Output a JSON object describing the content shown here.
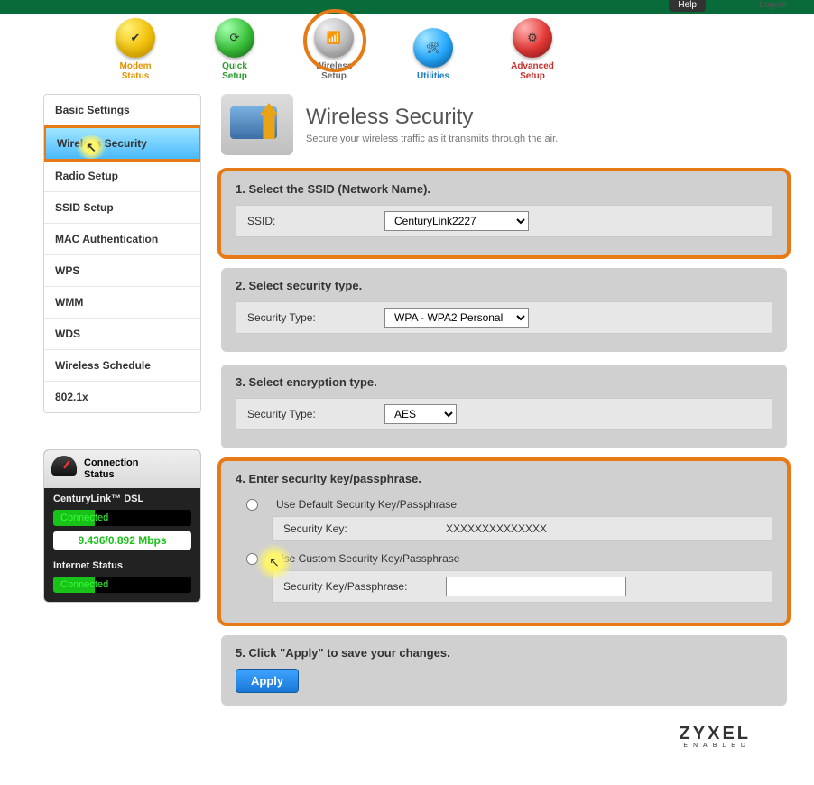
{
  "topbar": {
    "help": "Help",
    "logout": "Logout"
  },
  "nav": {
    "items": [
      {
        "label1": "Modem",
        "label2": "Status"
      },
      {
        "label1": "Quick",
        "label2": "Setup"
      },
      {
        "label1": "Wireless",
        "label2": "Setup"
      },
      {
        "label1": "Utilities",
        "label2": ""
      },
      {
        "label1": "Advanced",
        "label2": "Setup"
      }
    ]
  },
  "sidebar": {
    "items": [
      {
        "label": "Basic Settings"
      },
      {
        "label": "Wireless Security"
      },
      {
        "label": "Radio Setup"
      },
      {
        "label": "SSID Setup"
      },
      {
        "label": "MAC Authentication"
      },
      {
        "label": "WPS"
      },
      {
        "label": "WMM"
      },
      {
        "label": "WDS"
      },
      {
        "label": "Wireless Schedule"
      },
      {
        "label": "802.1x"
      }
    ]
  },
  "status": {
    "title1": "Connection",
    "title2": "Status",
    "dsl_title": "CenturyLink™ DSL",
    "dsl_state": "Connected",
    "speed": "9.436/0.892 Mbps",
    "internet_title": "Internet Status",
    "internet_state": "Connected"
  },
  "page": {
    "title": "Wireless Security",
    "subtitle": "Secure your wireless traffic as it transmits through the air."
  },
  "steps": {
    "one": {
      "heading": "1. Select the SSID (Network Name).",
      "label": "SSID:",
      "value": "CenturyLink2227"
    },
    "two": {
      "heading": "2. Select security type.",
      "label": "Security Type:",
      "value": "WPA - WPA2 Personal"
    },
    "three": {
      "heading": "3. Select encryption type.",
      "label": "Security Type:",
      "value": "AES"
    },
    "four": {
      "heading": "4. Enter security key/passphrase.",
      "opt_default": "Use Default Security Key/Passphrase",
      "default_key_label": "Security Key:",
      "default_key_value": "XXXXXXXXXXXXXX",
      "opt_custom": "Use Custom Security Key/Passphrase",
      "custom_key_label": "Security Key/Passphrase:",
      "custom_key_value": ""
    },
    "five": {
      "heading": "5. Click \"Apply\" to save your changes.",
      "button": "Apply"
    }
  },
  "footer": {
    "brand": "ZYXEL",
    "tagline": "ENABLED"
  }
}
